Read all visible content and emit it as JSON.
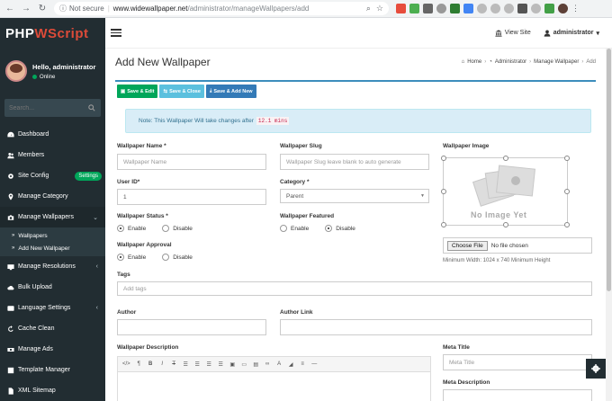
{
  "browser": {
    "security": "Not secure",
    "url_host": "www.widewallpaper.net",
    "url_path": "/administrator/manageWallpapers/add"
  },
  "sidebar": {
    "logo_a": "PHP",
    "logo_b": "WScript",
    "user_name": "Hello, administrator",
    "user_status": "Online",
    "search_placeholder": "Search...",
    "items": [
      {
        "label": "Dashboard",
        "icon": "dashboard-icon"
      },
      {
        "label": "Members",
        "icon": "users-icon"
      },
      {
        "label": "Site Config",
        "icon": "gears-icon",
        "badge": "Settings"
      },
      {
        "label": "Manage Category",
        "icon": "map-marker-icon"
      },
      {
        "label": "Manage Wallpapers",
        "icon": "camera-icon"
      },
      {
        "label": "Manage Resolutions",
        "icon": "desktop-icon"
      },
      {
        "label": "Bulk Upload",
        "icon": "cloud-upload-icon"
      },
      {
        "label": "Language Settings",
        "icon": "language-icon"
      },
      {
        "label": "Cache Clean",
        "icon": "refresh-icon"
      },
      {
        "label": "Manage Ads",
        "icon": "money-icon"
      },
      {
        "label": "Template Manager",
        "icon": "template-icon"
      },
      {
        "label": "XML Sitemap",
        "icon": "file-icon"
      }
    ],
    "submenu": [
      {
        "label": "Wallpapers"
      },
      {
        "label": "Add New Wallpaper"
      }
    ]
  },
  "topbar": {
    "view_site": "View Site",
    "user": "administrator"
  },
  "header": {
    "title": "Add New Wallpaper",
    "breadcrumb": [
      "Home",
      "Administrator",
      "Manage Wallpaper",
      "Add"
    ]
  },
  "actions": {
    "save_edit": "Save & Edit",
    "save_close": "Save & Close",
    "save_add": "Save & Add New"
  },
  "note": {
    "text": "Note: This Wallpaper Will take changes after",
    "code": "12.1 mins"
  },
  "form": {
    "name_label": "Wallpaper Name *",
    "name_placeholder": "Wallpaper Name",
    "slug_label": "Wallpaper Slug",
    "slug_placeholder": "Wallpaper Slug leave blank to auto generate",
    "image_label": "Wallpaper Image",
    "user_id_label": "User ID*",
    "user_id_value": "1",
    "category_label": "Category *",
    "category_value": "Parent",
    "status_label": "Wallpaper Status *",
    "featured_label": "Wallpaper Featured",
    "approval_label": "Wallpaper Approval",
    "enable": "Enable",
    "disable": "Disable",
    "no_image": "No Image Yet",
    "choose_file": "Choose File",
    "no_file": "No file chosen",
    "min_hint": "Minimum Width: 1024 x 740 Minimum Height",
    "tags_label": "Tags",
    "tags_placeholder": "Add tags",
    "author_label": "Author",
    "author_link_label": "Author Link",
    "description_label": "Wallpaper Description",
    "meta_title_label": "Meta Title",
    "meta_title_placeholder": "Meta Title",
    "meta_description_label": "Meta Description"
  },
  "editor_tools": [
    "</>",
    "¶",
    "B",
    "I",
    "T",
    "☰",
    "☰",
    "☰",
    "☰",
    "▣",
    "▭",
    "▤",
    "∞",
    "A",
    "◢",
    "≡",
    "—"
  ],
  "colors": {
    "sidebar_bg": "#222d32",
    "accent": "#3c8dbc",
    "brand_red": "#dd4b39",
    "green": "#00a65a"
  }
}
